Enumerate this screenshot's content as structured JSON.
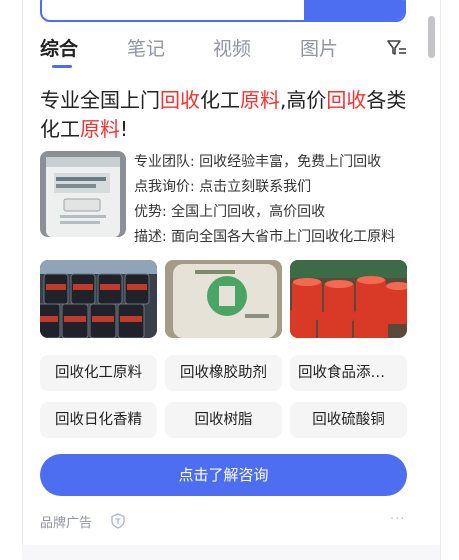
{
  "tabs": [
    {
      "label": "综合",
      "active": true
    },
    {
      "label": "笔记",
      "active": false
    },
    {
      "label": "视频",
      "active": false
    },
    {
      "label": "图片",
      "active": false
    }
  ],
  "title": {
    "parts": [
      "专业全国上门",
      "回收",
      "化工",
      "原料",
      ",高价",
      "回收",
      "各类化工",
      "原料",
      "!"
    ]
  },
  "info": [
    "专业团队: 回收经验丰富，免费上门回收",
    "点我询价: 点击立刻联系我们",
    "优势: 全国上门回收，高价回收",
    "描述: 面向全国各大省市上门回收化工原料"
  ],
  "chips": [
    "回收化工原料",
    "回收橡胶助剂",
    "回收食品添加剂",
    "回收日化香精",
    "回收树脂",
    "回收硫酸铜"
  ],
  "cta": "点击了解咨询",
  "brand": "品牌广告",
  "more": "···",
  "colors": {
    "accent": "#4e6ef2",
    "highlight": "#f73131",
    "muted": "#9195a3"
  },
  "icons": [
    "filter-icon",
    "brand-shield-icon",
    "more-dots-icon"
  ]
}
